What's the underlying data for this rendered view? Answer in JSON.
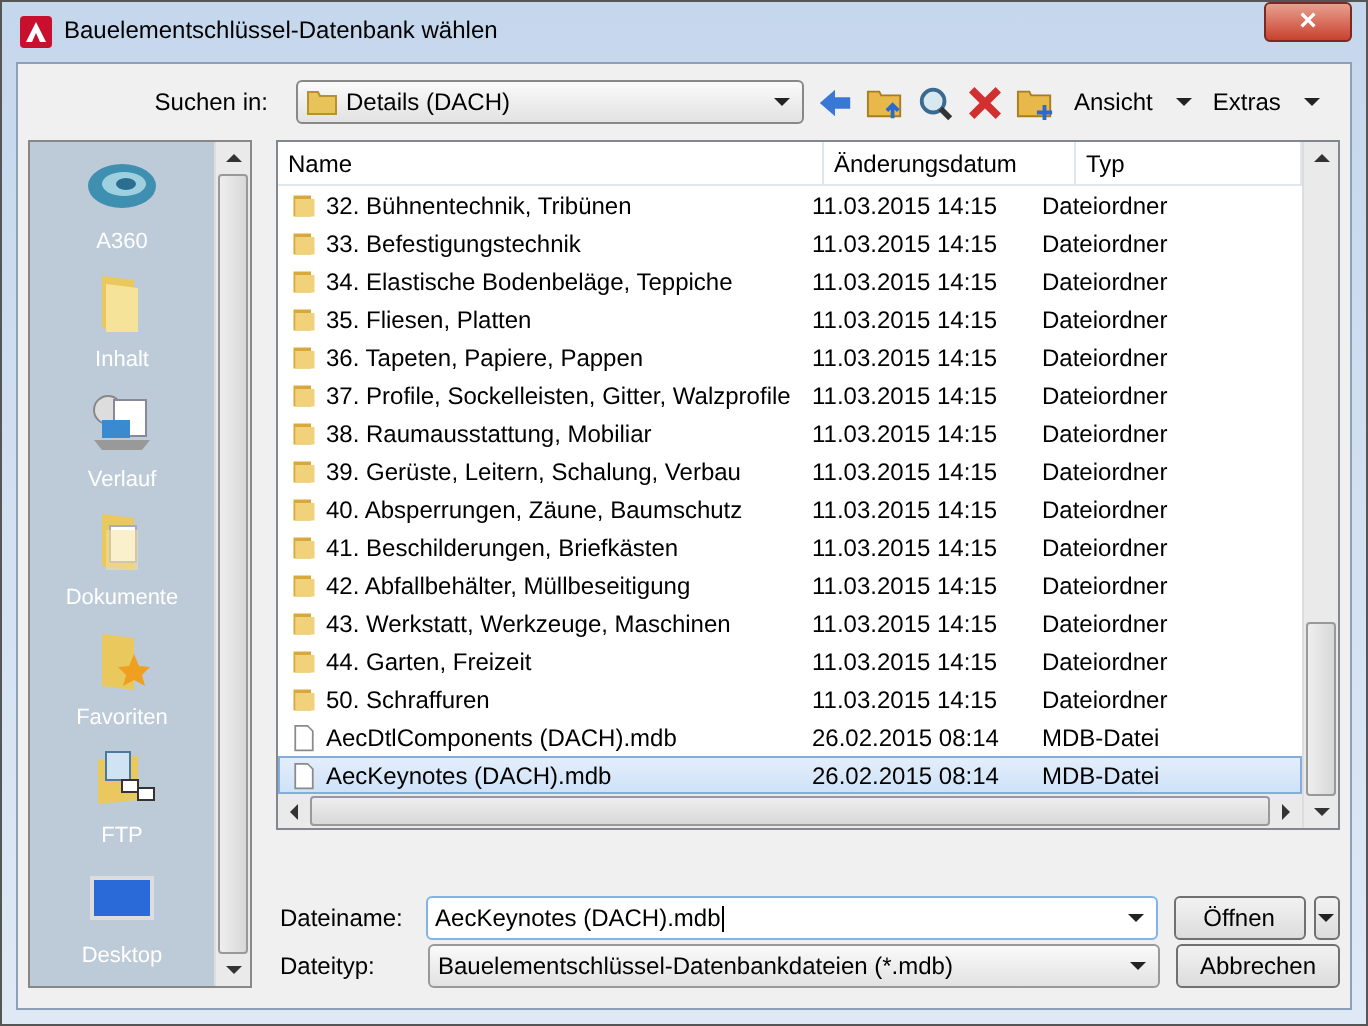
{
  "window": {
    "title": "Bauelementschlüssel-Datenbank wählen",
    "close": "×"
  },
  "look_in": {
    "label": "Suchen in:",
    "value": "Details (DACH)"
  },
  "toolbar": {
    "menus": [
      "Ansicht",
      "Extras"
    ]
  },
  "sidebar": {
    "items": [
      {
        "kind": "cloud",
        "label": "A360"
      },
      {
        "kind": "folder",
        "label": "Inhalt"
      },
      {
        "kind": "history",
        "label": "Verlauf"
      },
      {
        "kind": "documents",
        "label": "Dokumente"
      },
      {
        "kind": "favorites",
        "label": "Favoriten"
      },
      {
        "kind": "ftp",
        "label": "FTP"
      },
      {
        "kind": "desktop",
        "label": "Desktop"
      }
    ]
  },
  "table": {
    "columns": [
      "Name",
      "Änderungsdatum",
      "Typ"
    ],
    "rows": [
      {
        "kind": "folder",
        "name": "32. Bühnentechnik, Tribünen",
        "date": "11.03.2015 14:15",
        "type": "Dateiordner",
        "selected": false
      },
      {
        "kind": "folder",
        "name": "33. Befestigungstechnik",
        "date": "11.03.2015 14:15",
        "type": "Dateiordner",
        "selected": false
      },
      {
        "kind": "folder",
        "name": "34. Elastische Bodenbeläge, Teppiche",
        "date": "11.03.2015 14:15",
        "type": "Dateiordner",
        "selected": false
      },
      {
        "kind": "folder",
        "name": "35. Fliesen, Platten",
        "date": "11.03.2015 14:15",
        "type": "Dateiordner",
        "selected": false
      },
      {
        "kind": "folder",
        "name": "36. Tapeten, Papiere, Pappen",
        "date": "11.03.2015 14:15",
        "type": "Dateiordner",
        "selected": false
      },
      {
        "kind": "folder",
        "name": "37. Profile, Sockelleisten, Gitter, Walzprofile",
        "date": "11.03.2015 14:15",
        "type": "Dateiordner",
        "selected": false
      },
      {
        "kind": "folder",
        "name": "38. Raumausstattung, Mobiliar",
        "date": "11.03.2015 14:15",
        "type": "Dateiordner",
        "selected": false
      },
      {
        "kind": "folder",
        "name": "39. Gerüste, Leitern, Schalung, Verbau",
        "date": "11.03.2015 14:15",
        "type": "Dateiordner",
        "selected": false
      },
      {
        "kind": "folder",
        "name": "40. Absperrungen, Zäune, Baumschutz",
        "date": "11.03.2015 14:15",
        "type": "Dateiordner",
        "selected": false
      },
      {
        "kind": "folder",
        "name": "41. Beschilderungen, Briefkästen",
        "date": "11.03.2015 14:15",
        "type": "Dateiordner",
        "selected": false
      },
      {
        "kind": "folder",
        "name": "42. Abfallbehälter, Müllbeseitigung",
        "date": "11.03.2015 14:15",
        "type": "Dateiordner",
        "selected": false
      },
      {
        "kind": "folder",
        "name": "43. Werkstatt, Werkzeuge, Maschinen",
        "date": "11.03.2015 14:15",
        "type": "Dateiordner",
        "selected": false
      },
      {
        "kind": "folder",
        "name": "44. Garten, Freizeit",
        "date": "11.03.2015 14:15",
        "type": "Dateiordner",
        "selected": false
      },
      {
        "kind": "folder",
        "name": "50. Schraffuren",
        "date": "11.03.2015 14:15",
        "type": "Dateiordner",
        "selected": false
      },
      {
        "kind": "file",
        "name": "AecDtlComponents (DACH).mdb",
        "date": "26.02.2015 08:14",
        "type": "MDB-Datei",
        "selected": false
      },
      {
        "kind": "file",
        "name": "AecKeynotes (DACH).mdb",
        "date": "26.02.2015 08:14",
        "type": "MDB-Datei",
        "selected": true
      }
    ]
  },
  "filename": {
    "label": "Dateiname:",
    "value": "AecKeynotes (DACH).mdb"
  },
  "filetype": {
    "label": "Dateityp:",
    "value": "Bauelementschlüssel-Datenbankdateien (*.mdb)"
  },
  "buttons": [
    "Öffnen",
    "Abbrechen"
  ]
}
